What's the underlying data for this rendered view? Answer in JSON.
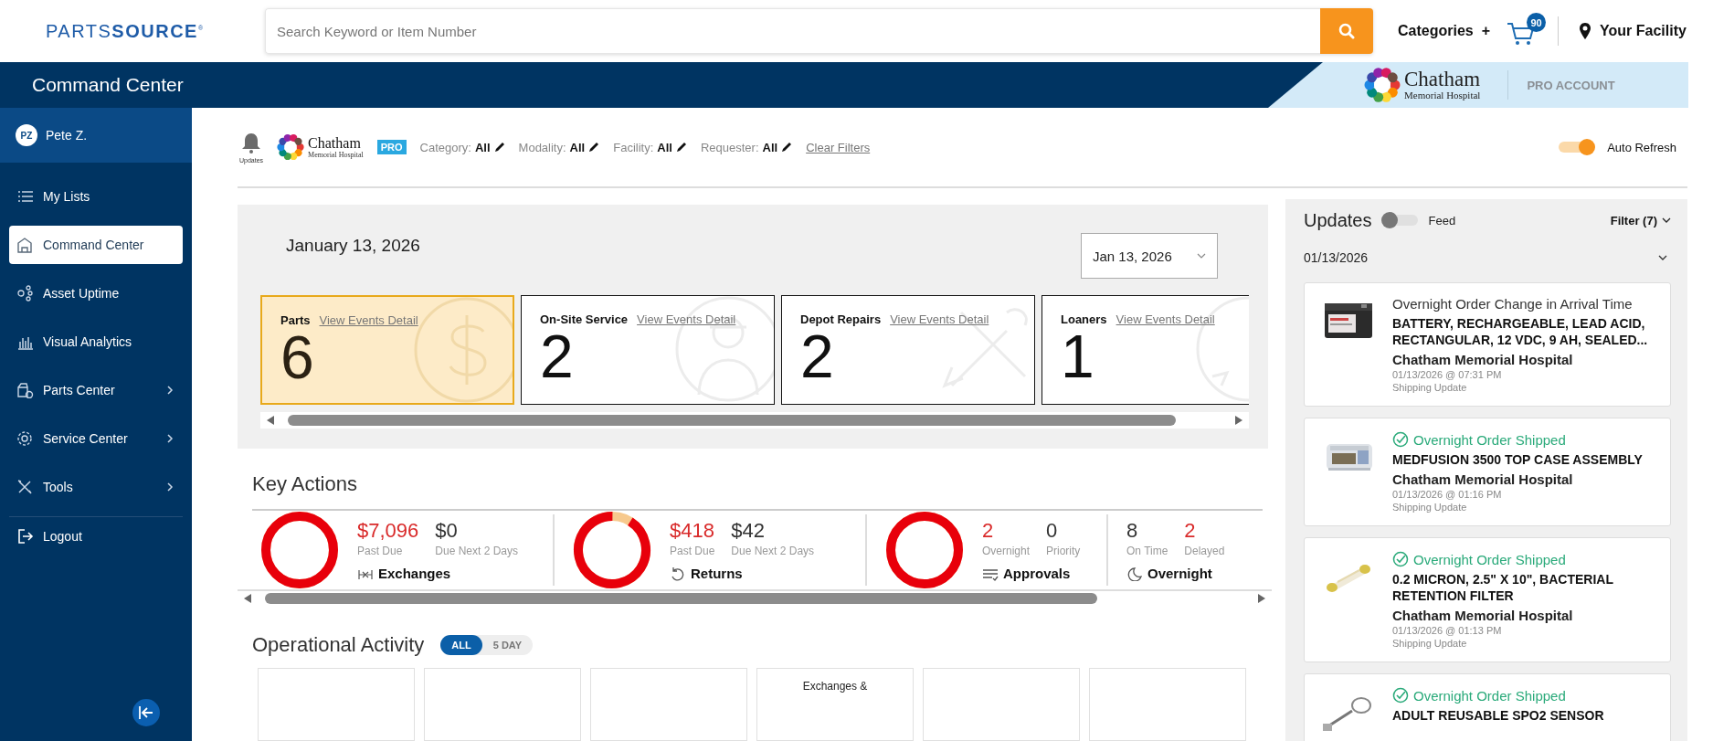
{
  "header": {
    "logo": "PARTS**SOURCE**$^{®}$",
    "search": {
      "placeholder": "Search Keyword or Item Number"
    },
    "categories": "Categories",
    "categories_plus": "+",
    "cart_count": "90",
    "facility": "Your Facility"
  },
  "titlebar": {
    "title": "Command Center",
    "org": {
      "name": "Chatham",
      "subtitle": "Memorial Hospital"
    },
    "account": "PRO ACCOUNT"
  },
  "sidebar": {
    "user": {
      "initials": "PZ",
      "name": "Pete Z."
    },
    "items": [
      {
        "label": "My Lists",
        "selected": false,
        "submenu": false
      },
      {
        "label": "Command Center",
        "selected": true,
        "submenu": false
      },
      {
        "label": "Asset Uptime",
        "selected": false,
        "submenu": false
      },
      {
        "label": "Visual Analytics",
        "selected": false,
        "submenu": false
      },
      {
        "label": "Parts Center",
        "selected": false,
        "submenu": true
      },
      {
        "label": "Service Center",
        "selected": false,
        "submenu": true
      },
      {
        "label": "Tools",
        "selected": false,
        "submenu": true
      }
    ],
    "logout": "Logout"
  },
  "filter_bar": {
    "bell_label": "Updates",
    "org": {
      "name": "Chatham",
      "subtitle": "Memorial Hospital"
    },
    "badge": "PRO",
    "filters": [
      {
        "label": "Category:",
        "value": "All"
      },
      {
        "label": "Modality:",
        "value": "All"
      },
      {
        "label": "Facility:",
        "value": "All"
      },
      {
        "label": "Requester:",
        "value": "All"
      }
    ],
    "clear": "Clear Filters",
    "auto_refresh": {
      "label": "Auto Refresh",
      "on": true
    }
  },
  "events": {
    "date": "January 13, 2026",
    "picker": "Jan 13, 2026",
    "cards": [
      {
        "title": "Parts",
        "link": "View Events Detail",
        "count": "6",
        "selected": true,
        "kind": "dollar"
      },
      {
        "title": "On-Site Service",
        "link": "View Events Detail",
        "count": "2",
        "selected": false,
        "kind": "technician"
      },
      {
        "title": "Depot Repairs",
        "link": "View Events Detail",
        "count": "2",
        "selected": false,
        "kind": "tools"
      },
      {
        "title": "Loaners",
        "link": "View Events Detail",
        "count": "1",
        "selected": false,
        "kind": "loaner"
      }
    ]
  },
  "key_actions": {
    "title": "Key Actions",
    "groups": [
      {
        "kind": "donut",
        "level": 1,
        "name": "Exchanges",
        "stats": [
          {
            "value": "$7,096",
            "label": "Past Due",
            "alert": true
          },
          {
            "value": "$0",
            "label": "Due Next 2 Days",
            "alert": false
          }
        ]
      },
      {
        "kind": "donut",
        "level": 0.91,
        "name": "Returns",
        "stats": [
          {
            "value": "$418",
            "label": "Past Due",
            "alert": true
          },
          {
            "value": "$42",
            "label": "Due Next 2 Days",
            "alert": false
          }
        ]
      },
      {
        "kind": "donut",
        "level": 1,
        "name": "Approvals",
        "stats": [
          {
            "value": "2",
            "label": "Overnight",
            "alert": true
          },
          {
            "value": "0",
            "label": "Priority",
            "alert": false
          }
        ]
      },
      {
        "kind": "plain",
        "name": "Overnight",
        "stats": [
          {
            "value": "8",
            "label": "On Time",
            "alert": false
          },
          {
            "value": "2",
            "label": "Delayed",
            "alert": true
          }
        ]
      }
    ]
  },
  "operational_activity": {
    "title": "Operational Activity",
    "tabs": [
      {
        "label": "ALL",
        "selected": true
      },
      {
        "label": "5 DAY",
        "selected": false
      }
    ],
    "cards": [
      {
        "kind": "blank"
      },
      {
        "kind": "blank"
      },
      {
        "kind": "blank"
      },
      {
        "kind": "titled",
        "title": "Exchanges &"
      },
      {
        "kind": "blank"
      },
      {
        "kind": "blank"
      }
    ]
  },
  "updates": {
    "title": "Updates",
    "feed": {
      "label": "Feed",
      "on": false
    },
    "filter": "Filter (7)",
    "date": "01/13/2026",
    "items": [
      {
        "kind": "change",
        "headline": "Overnight Order Change in Arrival Time",
        "product": "BATTERY, RECHARGEABLE, LEAD ACID, RECTANGULAR, 12 VDC, 9 AH, SEALED...",
        "facility": "Chatham Memorial Hospital",
        "time": "01/13/2026 @ 07:31 PM",
        "type": "Shipping Update"
      },
      {
        "kind": "shipped",
        "headline": "Overnight Order Shipped",
        "product": "MEDFUSION 3500 TOP CASE ASSEMBLY",
        "facility": "Chatham Memorial Hospital",
        "time": "01/13/2026 @ 01:16 PM",
        "type": "Shipping Update"
      },
      {
        "kind": "shipped",
        "headline": "Overnight Order Shipped",
        "product": "0.2 MICRON, 2.5\" X 10\", BACTERIAL RETENTION FILTER",
        "facility": "Chatham Memorial Hospital",
        "time": "01/13/2026 @ 01:13 PM",
        "type": "Shipping Update"
      },
      {
        "kind": "shipped",
        "headline": "Overnight Order Shipped",
        "product": "ADULT REUSABLE SPO2 SENSOR"
      }
    ]
  }
}
